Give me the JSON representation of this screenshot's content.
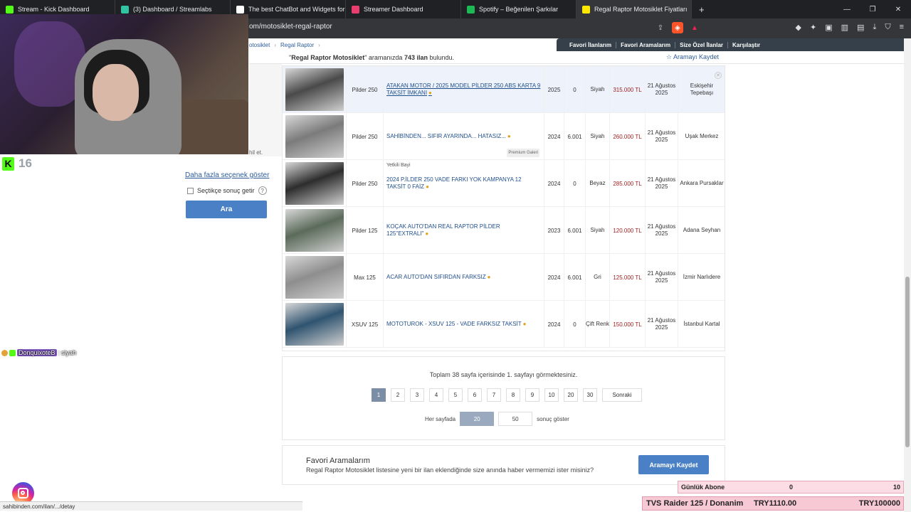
{
  "browser": {
    "tabs": [
      {
        "title": "Stream - Kick Dashboard",
        "color": "#53fc18"
      },
      {
        "title": "(3) Dashboard / Streamlabs",
        "color": "#31c3a2"
      },
      {
        "title": "The best ChatBot and Widgets for Ki",
        "color": "#ffffff"
      },
      {
        "title": "Streamer Dashboard",
        "color": "#e83e6f"
      },
      {
        "title": "Spotify – Beğenilen Şarkılar",
        "color": "#1db954"
      },
      {
        "title": "Regal Raptor Motosiklet Fiyatları",
        "color": "#ffe800",
        "active": true
      }
    ],
    "url": "om/motosiklet-regal-raptor",
    "window_controls": [
      "—",
      "❐",
      "✕"
    ]
  },
  "site": {
    "breadcrumb": [
      "otosiklet",
      "Regal Raptor"
    ],
    "nav": [
      "Favori İlanlarım",
      "Favori Aramalarım",
      "Size Özel İlanlar",
      "Karşılaştır"
    ],
    "result_pre": "\"",
    "result_query": "Regal Raptor Motosiklet",
    "result_mid": "\" aramanızda ",
    "result_count": "743 ilan",
    "result_post": " bulundu.",
    "save_search": "Aramayı Kaydet"
  },
  "filters": {
    "faded_text": "hil et.",
    "more_options": "Daha fazla seçenek göster",
    "checkbox_label": "Seçtikçe sonuç getir",
    "help": "?",
    "search_button": "Ara"
  },
  "listings": [
    {
      "model": "Pilder 250",
      "title": "ATAKAN MOTOR / 2025 MODEL PİLDER 250 ABS KARTA 9 TAKSİT İMKANI",
      "year": "2025",
      "km": "0",
      "color": "Siyah",
      "price": "315.000 TL",
      "date": "21 Ağustos 2025",
      "location": "Eskişehir Tepebaşı",
      "highlight": true,
      "img": "#4a4a4a"
    },
    {
      "model": "Pilder 250",
      "title": "SAHİBİNDEN... SIFIR AYARINDA... HATASIZ...",
      "year": "2024",
      "km": "6.001",
      "color": "Siyah",
      "price": "260.000 TL",
      "date": "21 Ağustos 2025",
      "location": "Uşak Merkez",
      "premium": "Premium Galeri",
      "img": "#7b7b7b"
    },
    {
      "model": "Pilder 250",
      "title": "2024 P.İLDER 250 VADE FARKI YOK KAMPANYA 12 TAKSİT 0 FAİZ",
      "year": "2024",
      "km": "0",
      "color": "Beyaz",
      "price": "285.000 TL",
      "date": "21 Ağustos 2025",
      "location": "Ankara Pursaklar",
      "dealer": "Yetkili Bayi",
      "img": "#2d2d2d"
    },
    {
      "model": "Pilder 125",
      "title": "KOÇAK AUTO'DAN REAL RAPTOR PİLDER 125\"EXTRALI\"",
      "year": "2023",
      "km": "6.001",
      "color": "Siyah",
      "price": "120.000 TL",
      "date": "21 Ağustos 2025",
      "location": "Adana Seyhan",
      "img": "#5b6b5a"
    },
    {
      "model": "Max 125",
      "title": "ACAR AUTO'DAN SIFIRDAN FARKSIZ",
      "year": "2024",
      "km": "6.001",
      "color": "Gri",
      "price": "125.000 TL",
      "date": "21 Ağustos 2025",
      "location": "İzmir Narlıdere",
      "img": "#8e8e8e"
    },
    {
      "model": "XSUV 125",
      "title": "MOTOTUROK - XSUV 125 - VADE FARKSIZ TAKSİT",
      "year": "2024",
      "km": "0",
      "color": "Çift Renk",
      "price": "150.000 TL",
      "date": "21 Ağustos 2025",
      "location": "İstanbul Kartal",
      "img": "#2f5470"
    }
  ],
  "pagination": {
    "summary": "Toplam 38 sayfa içerisinde 1. sayfayı görmektesiniz.",
    "pages": [
      "1",
      "2",
      "3",
      "4",
      "5",
      "6",
      "7",
      "8",
      "9",
      "10",
      "20",
      "30"
    ],
    "current": "1",
    "next": "Sonraki",
    "per_page_label": "Her sayfada",
    "per_page_options": [
      "20",
      "50"
    ],
    "per_page_current": "20",
    "per_page_suffix": "sonuç göster"
  },
  "favorites": {
    "title": "Favori Aramalarım",
    "desc": "Regal Raptor Motosiklet listesine yeni bir ilan eklendiğinde size anında haber vermemizi ister misiniz?",
    "button": "Aramayı Kaydet"
  },
  "overlay": {
    "sub_icon": "K",
    "sub_count": "16",
    "chat_user": "DonquixoteB",
    "chat_sep": ":",
    "chat_text": "siyah",
    "status_url": "sahibinden.com/ilan/.../detay",
    "goal_label": "Günlük Abone",
    "goal_current": "0",
    "goal_max": "10",
    "donate_label": "TVS Raider 125 / Donanim",
    "donate_current": "TRY1110.00",
    "donate_max": "TRY100000"
  }
}
